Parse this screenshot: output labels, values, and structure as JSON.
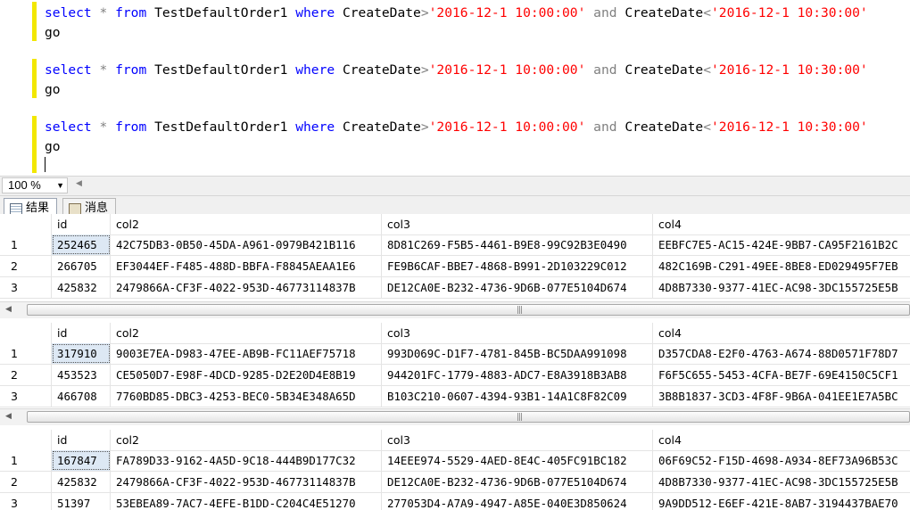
{
  "editor": {
    "lines": [
      {
        "kw1": "select",
        "star": "*",
        "kw2": "from",
        "table": "TestDefaultOrder1",
        "kw3": "where",
        "col1": "CreateDate",
        ">": ">",
        "v1": "'2016-12-1 10:00:00'",
        "and": "and",
        "col2": "CreateDate",
        "<": "<",
        "v2": "'2016-12-1 10:30:00'"
      },
      {
        "kw1": "select",
        "star": "*",
        "kw2": "from",
        "table": "TestDefaultOrder1",
        "kw3": "where",
        "col1": "CreateDate",
        ">": ">",
        "v1": "'2016-12-1 10:00:00'",
        "and": "and",
        "col2": "CreateDate",
        "<": "<",
        "v2": "'2016-12-1 10:30:00'"
      },
      {
        "kw1": "select",
        "star": "*",
        "kw2": "from",
        "table": "TestDefaultOrder1",
        "kw3": "where",
        "col1": "CreateDate",
        ">": ">",
        "v1": "'2016-12-1 10:00:00'",
        "and": "and",
        "col2": "CreateDate",
        "<": "<",
        "v2": "'2016-12-1 10:30:00'"
      }
    ],
    "go": "go"
  },
  "zoom": {
    "value": "100 %"
  },
  "tabs": {
    "results": "结果",
    "messages": "消息"
  },
  "results": [
    {
      "headers": [
        "id",
        "col2",
        "col3",
        "col4"
      ],
      "rows": [
        {
          "n": "1",
          "id": "252465",
          "col2": "42C75DB3-0B50-45DA-A961-0979B421B116",
          "col3": "8D81C269-F5B5-4461-B9E8-99C92B3E0490",
          "col4": "EEBFC7E5-AC15-424E-9BB7-CA95F2161B2C"
        },
        {
          "n": "2",
          "id": "266705",
          "col2": "EF3044EF-F485-488D-BBFA-F8845AEAA1E6",
          "col3": "FE9B6CAF-BBE7-4868-B991-2D103229C012",
          "col4": "482C169B-C291-49EE-8BE8-ED029495F7EB"
        },
        {
          "n": "3",
          "id": "425832",
          "col2": "2479866A-CF3F-4022-953D-46773114837B",
          "col3": "DE12CA0E-B232-4736-9D6B-077E5104D674",
          "col4": "4D8B7330-9377-41EC-AC98-3DC155725E5B"
        }
      ]
    },
    {
      "headers": [
        "id",
        "col2",
        "col3",
        "col4"
      ],
      "rows": [
        {
          "n": "1",
          "id": "317910",
          "col2": "9003E7EA-D983-47EE-AB9B-FC11AEF75718",
          "col3": "993D069C-D1F7-4781-845B-BC5DAA991098",
          "col4": "D357CDA8-E2F0-4763-A674-88D0571F78D7"
        },
        {
          "n": "2",
          "id": "453523",
          "col2": "CE5050D7-E98F-4DCD-9285-D2E20D4E8B19",
          "col3": "944201FC-1779-4883-ADC7-E8A3918B3AB8",
          "col4": "F6F5C655-5453-4CFA-BE7F-69E4150C5CF1"
        },
        {
          "n": "3",
          "id": "466708",
          "col2": "7760BD85-DBC3-4253-BEC0-5B34E348A65D",
          "col3": "B103C210-0607-4394-93B1-14A1C8F82C09",
          "col4": "3B8B1837-3CD3-4F8F-9B6A-041EE1E7A5BC"
        }
      ]
    },
    {
      "headers": [
        "id",
        "col2",
        "col3",
        "col4"
      ],
      "rows": [
        {
          "n": "1",
          "id": "167847",
          "col2": "FA789D33-9162-4A5D-9C18-444B9D177C32",
          "col3": "14EEE974-5529-4AED-8E4C-405FC91BC182",
          "col4": "06F69C52-F15D-4698-A934-8EF73A96B53C"
        },
        {
          "n": "2",
          "id": "425832",
          "col2": "2479866A-CF3F-4022-953D-46773114837B",
          "col3": "DE12CA0E-B232-4736-9D6B-077E5104D674",
          "col4": "4D8B7330-9377-41EC-AC98-3DC155725E5B"
        },
        {
          "n": "3",
          "id": "51397",
          "col2": "53EBEA89-7AC7-4EFE-B1DD-C204C4E51270",
          "col3": "277053D4-A7A9-4947-A85E-040E3D850624",
          "col4": "9A9DD512-E6EF-421E-8AB7-3194437BAE70"
        }
      ]
    }
  ]
}
